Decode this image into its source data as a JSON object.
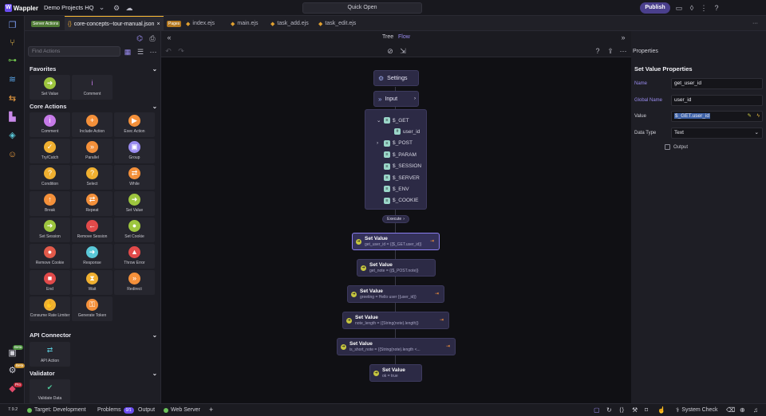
{
  "app": {
    "name": "Wappler",
    "project": "Demo Projects HQ",
    "quick_open": "Quick Open",
    "publish": "Publish"
  },
  "tabs": [
    {
      "chip": "Server Actions",
      "label": "core-concepts--tour-manual.json",
      "close": "×"
    },
    {
      "chip": "Pages",
      "label": ""
    },
    {
      "label": "index.ejs"
    },
    {
      "label": "main.ejs"
    },
    {
      "label": "task_add.ejs"
    },
    {
      "label": "task_edit.ejs"
    }
  ],
  "more": "···",
  "actions": {
    "search_placeholder": "Find Actions",
    "sections": {
      "favorites": "Favorites",
      "core": "Core Actions",
      "api": "API Connector",
      "validator": "Validator"
    },
    "favorites": [
      "Set Value",
      "Comment"
    ],
    "core": [
      "Comment",
      "Include Action",
      "Exec Action",
      "Try/Catch",
      "Parallel",
      "Group",
      "Condition",
      "Select",
      "While",
      "Break",
      "Repeat",
      "Set Value",
      "Set Session",
      "Remove Session",
      "Set Cookie",
      "Remove Cookie",
      "Response",
      "Throw Error",
      "End",
      "Wait",
      "Redirect",
      "Consume Rate Limiter",
      "Generate Token"
    ],
    "api": [
      "API Action"
    ],
    "validator": [
      "Validate Data"
    ]
  },
  "canvas": {
    "view_tree": "Tree",
    "view_flow": "Flow",
    "settings": "Settings",
    "input": "Input",
    "input_rows": [
      "$_GET",
      "user_id",
      "$_POST",
      "$_PARAM",
      "$_SESSION",
      "$_SERVER",
      "$_ENV",
      "$_COOKIE"
    ],
    "execute": "Execute",
    "steps": [
      {
        "title": "Set Value",
        "sub": "get_user_id = {{$_GET.user_id}}"
      },
      {
        "title": "Set Value",
        "sub": "get_note = {{$_POST.note}}"
      },
      {
        "title": "Set Value",
        "sub": "greeting = Hello user {{user_id}}"
      },
      {
        "title": "Set Value",
        "sub": "note_length = {{String(note).length}}"
      },
      {
        "title": "Set Value",
        "sub": "is_short_note = {{String(note).length <..."
      },
      {
        "title": "Set Value",
        "sub": "ok = true"
      }
    ]
  },
  "properties": {
    "header": "Properties",
    "title": "Set Value Properties",
    "name_label": "Name",
    "name_value": "get_user_id",
    "global_label": "Global Name",
    "global_value": "user_id",
    "value_label": "Value",
    "value_value": "$_GET.user_id",
    "type_label": "Data Type",
    "type_value": "Text",
    "output_label": "Output"
  },
  "status": {
    "version": "7.9.2",
    "target": "Target: Development",
    "problems": "Problems",
    "problems_count": "0/1",
    "output": "Output",
    "web_server": "Web Server",
    "system_check": "System Check"
  },
  "rail_badges": [
    "Beta",
    "Beta",
    "Pro"
  ]
}
